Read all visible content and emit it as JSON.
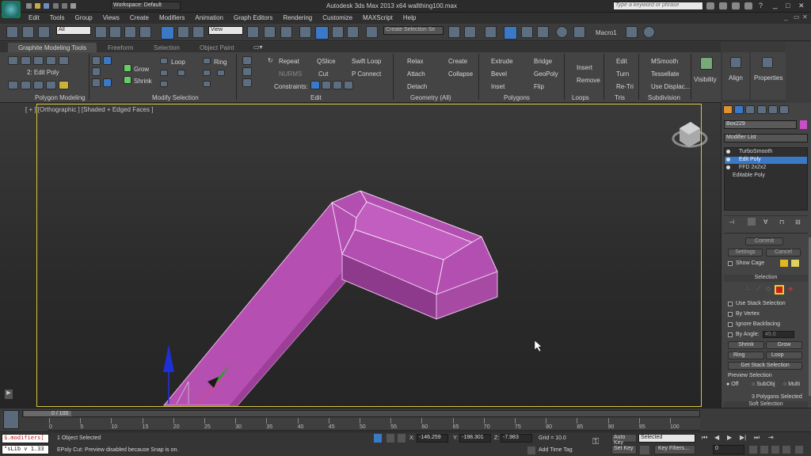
{
  "titlebar": {
    "workspace": "Workspace: Default",
    "title": "Autodesk 3ds Max  2013 x64     wallthing100.max",
    "search_placeholder": "Type a keyword or phrase"
  },
  "menu": [
    "Edit",
    "Tools",
    "Group",
    "Views",
    "Create",
    "Modifiers",
    "Animation",
    "Graph Editors",
    "Rendering",
    "Customize",
    "MAXScript",
    "Help"
  ],
  "toolbar": {
    "filter_value": "All",
    "ref_coord_value": "View",
    "named_selection_placeholder": "Create Selection Se",
    "macro_label": "Macro1"
  },
  "ribbon": {
    "tabs": [
      "Graphite Modeling Tools",
      "Freeform",
      "Selection",
      "Object Paint"
    ],
    "polygon_modeling": {
      "edit_poly": "2: Edit Poly",
      "section": "Polygon Modeling"
    },
    "modify_selection": {
      "grow": "Grow",
      "shrink": "Shrink",
      "loop": "Loop",
      "ring": "Ring",
      "section": "Modify Selection"
    },
    "edit": {
      "repeat": "Repeat",
      "qslice": "QSlice",
      "swift_loop": "Swift Loop",
      "nurms": "NURMS",
      "cut": "Cut",
      "p_connect": "P Connect",
      "constraints": "Constraints:",
      "section": "Edit"
    },
    "geometry": {
      "relax": "Relax",
      "create": "Create",
      "attach": "Attach",
      "collapse": "Collapse",
      "detach": "Detach",
      "section": "Geometry (All)"
    },
    "polygons": {
      "extrude": "Extrude",
      "bridge": "Bridge",
      "bevel": "Bevel",
      "geopoly": "GeoPoly",
      "inset": "Inset",
      "flip": "Flip",
      "section": "Polygons"
    },
    "loops": {
      "insert": "Insert",
      "remove": "Remove",
      "section": "Loops"
    },
    "tris": {
      "edit": "Edit",
      "turn": "Turn",
      "retri": "Re-Tri",
      "section": "Tris"
    },
    "subdivision": {
      "msmooth": "MSmooth",
      "tessellate": "Tessellate",
      "use_displace": "Use Displac...",
      "section": "Subdivision"
    },
    "visibility": "Visibility",
    "align": "Align",
    "properties": "Properties"
  },
  "viewport": {
    "label": "[ + ] [Orthographic ] [Shaded + Edged Faces ]",
    "colors": {
      "object": "#b24fb0",
      "border": "#d8c43a"
    }
  },
  "command_panel": {
    "object_name": "Box229",
    "modifier_list": "Modifier List",
    "stack": [
      "TurboSmooth",
      "Edit Poly",
      "FFD 2x2x2",
      "Editable Poly"
    ],
    "commit": "Commit",
    "settings": "Settings",
    "cancel": "Cancel",
    "show_cage": "Show Cage",
    "selection_header": "Selection",
    "use_stack": "Use Stack Selection",
    "by_vertex": "By Vertex",
    "ignore_backfacing": "Ignore Backfacing",
    "by_angle": "By Angle:",
    "by_angle_value": "45.0",
    "shrink": "Shrink",
    "grow": "Grow",
    "ring": "Ring",
    "loop": "Loop",
    "get_stack": "Get Stack Selection",
    "preview_selection": "Preview Selection",
    "preview_opts": [
      "Off",
      "SubObj",
      "Multi"
    ],
    "selected_info": "3 Polygons Selected",
    "soft_selection": "Soft Selection"
  },
  "timeline": {
    "frame": "0 / 100",
    "ticks": [
      "0",
      "5",
      "10",
      "15",
      "20",
      "25",
      "30",
      "35",
      "40",
      "45",
      "50",
      "55",
      "60",
      "65",
      "70",
      "75",
      "80",
      "85",
      "90",
      "95",
      "100"
    ]
  },
  "status": {
    "maxscript1": "$.modifiers[",
    "maxscript2": "\"sLib v 1.33",
    "objects_selected": "1 Object Selected",
    "prompt": "EPoly Cut: Preview disabled because Snap is on.",
    "x_label": "X:",
    "x": "-146.259",
    "y_label": "Y:",
    "y": "-198.301",
    "z_label": "Z:",
    "z": "-7.983",
    "grid": "Grid = 10.0",
    "add_time_tag": "Add Time Tag",
    "auto_key": "Auto Key",
    "set_key": "Set Key",
    "selected": "Selected",
    "key_filters": "Key Filters...",
    "frame_value": "0"
  }
}
